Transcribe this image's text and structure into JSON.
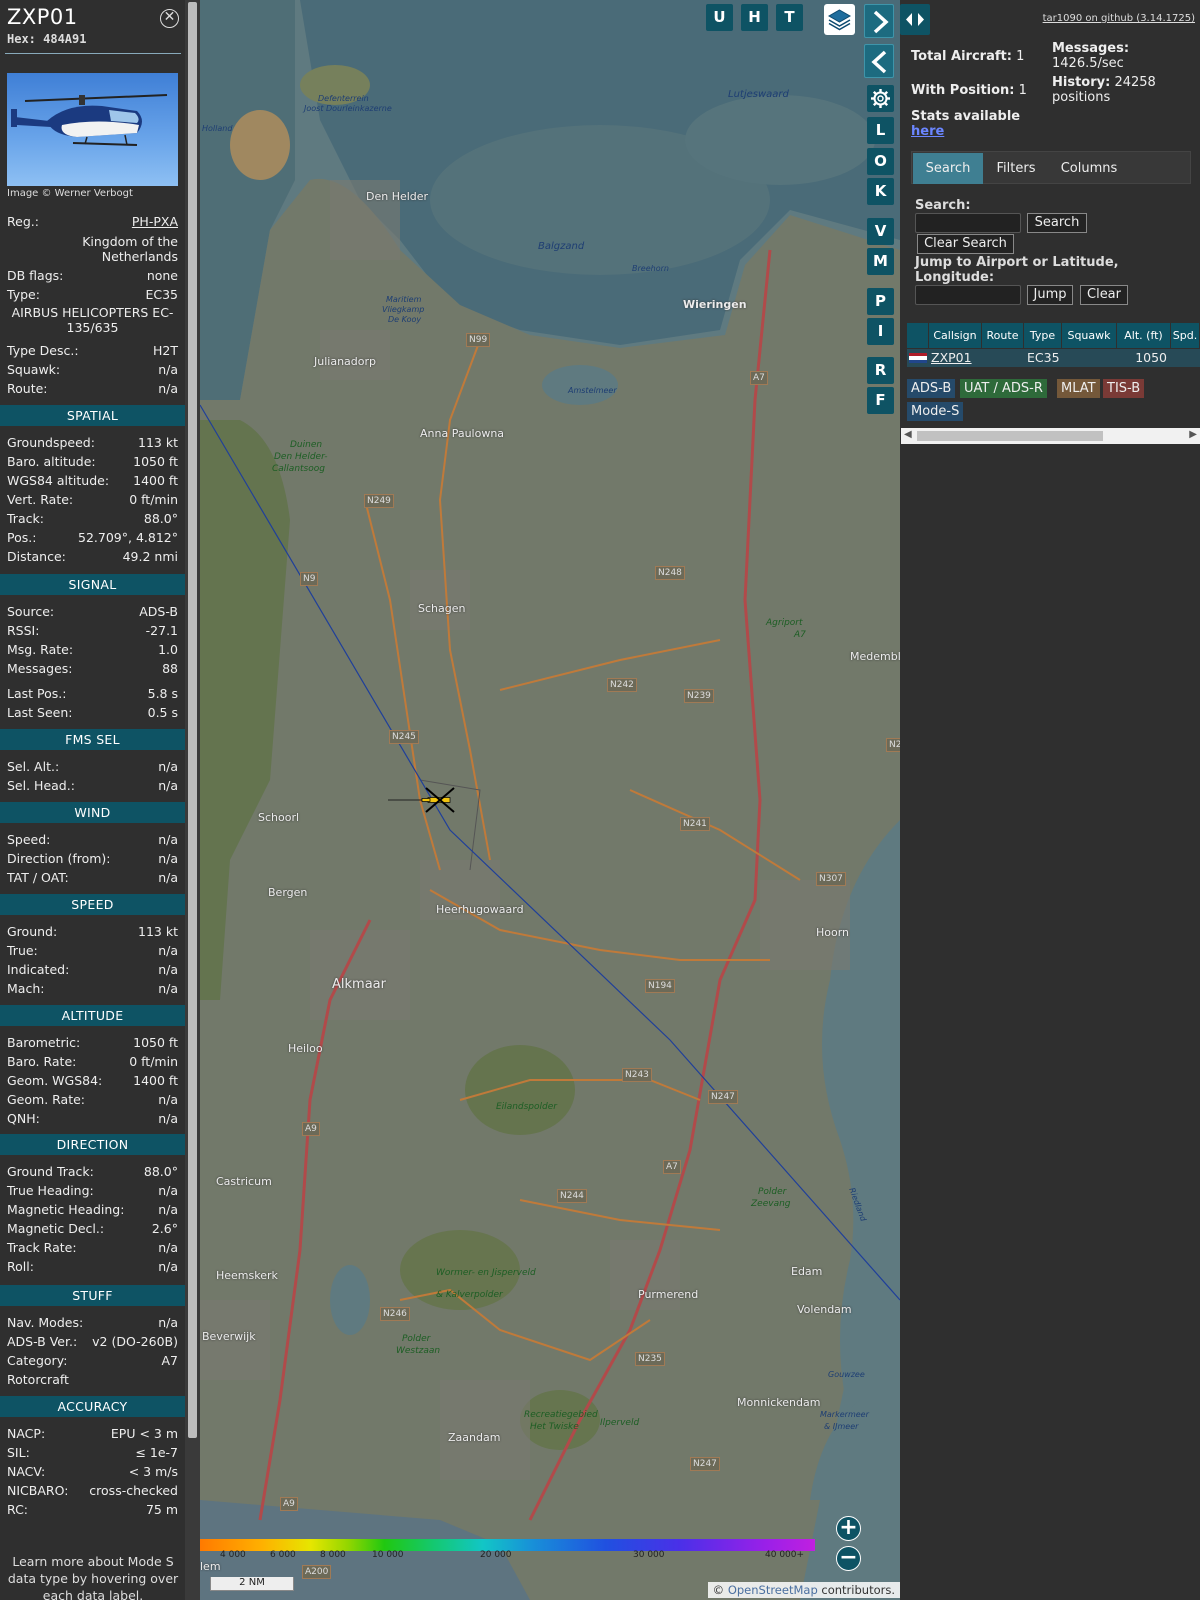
{
  "aircraft": {
    "callsign": "ZXP01",
    "hex": "Hex: 484A91",
    "close_icon": "close-icon",
    "photo_credit": "Image © Werner Verbogt"
  },
  "info": [
    {
      "k": "Reg.:",
      "v": "PH-PXA"
    },
    {
      "k": "",
      "v": "Kingdom of the Netherlands"
    },
    {
      "k": "DB flags:",
      "v": "none"
    },
    {
      "k": "Type:",
      "v": "EC35"
    },
    {
      "k": "",
      "v": "AIRBUS HELICOPTERS EC-135/635"
    },
    {
      "k": "Type Desc.:",
      "v": "H2T"
    },
    {
      "k": "Squawk:",
      "v": "n/a"
    },
    {
      "k": "Route:",
      "v": "n/a"
    }
  ],
  "sections": {
    "spatial": {
      "title": "SPATIAL",
      "rows": [
        {
          "k": "Groundspeed:",
          "v": "113 kt"
        },
        {
          "k": "Baro. altitude:",
          "v": "1050 ft"
        },
        {
          "k": "WGS84 altitude:",
          "v": "1400 ft"
        },
        {
          "k": "Vert. Rate:",
          "v": "0 ft/min"
        },
        {
          "k": "Track:",
          "v": "88.0°"
        },
        {
          "k": "Pos.:",
          "v": "52.709°, 4.812°"
        },
        {
          "k": "Distance:",
          "v": "49.2 nmi"
        }
      ]
    },
    "signal": {
      "title": "SIGNAL",
      "rows": [
        {
          "k": "Source:",
          "v": "ADS-B"
        },
        {
          "k": "RSSI:",
          "v": "-27.1"
        },
        {
          "k": "Msg. Rate:",
          "v": "1.0"
        },
        {
          "k": "Messages:",
          "v": "88"
        },
        {
          "k": "Last Pos.:",
          "v": "5.8 s"
        },
        {
          "k": "Last Seen:",
          "v": "0.5 s"
        }
      ]
    },
    "fms": {
      "title": "FMS SEL",
      "rows": [
        {
          "k": "Sel. Alt.:",
          "v": "n/a"
        },
        {
          "k": "Sel. Head.:",
          "v": "n/a"
        }
      ]
    },
    "wind": {
      "title": "WIND",
      "rows": [
        {
          "k": "Speed:",
          "v": "n/a"
        },
        {
          "k": "Direction (from):",
          "v": "n/a"
        },
        {
          "k": "TAT / OAT:",
          "v": "n/a"
        }
      ]
    },
    "speed": {
      "title": "SPEED",
      "rows": [
        {
          "k": "Ground:",
          "v": "113 kt"
        },
        {
          "k": "True:",
          "v": "n/a"
        },
        {
          "k": "Indicated:",
          "v": "n/a"
        },
        {
          "k": "Mach:",
          "v": "n/a"
        }
      ]
    },
    "altitude": {
      "title": "ALTITUDE",
      "rows": [
        {
          "k": "Barometric:",
          "v": "1050 ft"
        },
        {
          "k": "Baro. Rate:",
          "v": "0 ft/min"
        },
        {
          "k": "Geom. WGS84:",
          "v": "1400 ft"
        },
        {
          "k": "Geom. Rate:",
          "v": "n/a"
        },
        {
          "k": "QNH:",
          "v": "n/a"
        }
      ]
    },
    "direction": {
      "title": "DIRECTION",
      "rows": [
        {
          "k": "Ground Track:",
          "v": "88.0°"
        },
        {
          "k": "True Heading:",
          "v": "n/a"
        },
        {
          "k": "Magnetic Heading:",
          "v": "n/a"
        },
        {
          "k": "Magnetic Decl.:",
          "v": "2.6°"
        },
        {
          "k": "Track Rate:",
          "v": "n/a"
        },
        {
          "k": "Roll:",
          "v": "n/a"
        }
      ]
    },
    "stuff": {
      "title": "STUFF",
      "rows": [
        {
          "k": "Nav. Modes:",
          "v": "n/a"
        },
        {
          "k": "ADS-B Ver.:",
          "v": "v2 (DO-260B)"
        },
        {
          "k": "Category:",
          "v": "A7"
        },
        {
          "k": "Rotorcraft",
          "v": ""
        }
      ]
    },
    "accuracy": {
      "title": "ACCURACY",
      "rows": [
        {
          "k": "NACP:",
          "v": "EPU < 3 m"
        },
        {
          "k": "SIL:",
          "v": "≤ 1e-7"
        },
        {
          "k": "NACV:",
          "v": "< 3 m/s"
        },
        {
          "k": "NICBARO:",
          "v": "cross-checked"
        },
        {
          "k": "RC:",
          "v": "75 m"
        }
      ]
    }
  },
  "footer_note": "Learn more about Mode S data type by hovering over each data label.",
  "map": {
    "buttons_top": [
      "U",
      "H",
      "T"
    ],
    "side_buttons": [
      "L",
      "O",
      "K",
      "V",
      "M",
      "P",
      "I",
      "R",
      "F"
    ],
    "labels": {
      "den_helder": "Den Helder",
      "wieringen": "Wieringen",
      "julianadorp": "Julianadorp",
      "anna_paulowna": "Anna Paulowna",
      "schagen": "Schagen",
      "schoorl": "Schoorl",
      "bergen": "Bergen",
      "heerhugowaard": "Heerhugowaard",
      "hoorn": "Hoorn",
      "alkmaar": "Alkmaar",
      "heiloo": "Heiloo",
      "castricum": "Castricum",
      "heemskerk": "Heemskerk",
      "beverwijk": "Beverwijk",
      "purmerend": "Purmerend",
      "edam": "Edam",
      "volendam": "Volendam",
      "monnickendam": "Monnickendam",
      "zaandam": "Zaandam",
      "medemblik": "Medembli",
      "balgzand": "Balgzand",
      "breehorn": "Breehorn",
      "lutjeswaard": "Lutjeswaard",
      "amstelmeer": "Amstelmeer",
      "defenterrein": "Defenterrein",
      "kazerne": "Joost Dourleinkazerne",
      "vliegkamp1": "Maritiem",
      "vliegkamp2": "Vliegkamp",
      "vliegkamp3": "De Kooy",
      "duinen1": "Duinen",
      "duinen2": "Den Helder-",
      "duinen3": "Callantsoog",
      "agriport1": "Agriport",
      "agriport2": "A7",
      "eilandspolder": "Eilandspolder",
      "polder1": "Polder",
      "polder2": "Zeevang",
      "markermeer1": "Markermeer",
      "markermeer2": "& IJmeer",
      "gouwzee": "Gouwzee",
      "wormer1": "Wormer- en Jisperveld",
      "wormer2": "& Kalverpolder",
      "westzaan1": "Polder",
      "westzaan2": "Westzaan",
      "twiske1": "Recreatiegebied",
      "twiske2": "Het Twiske",
      "ilperveld": "Ilperveld",
      "leek": "Holland",
      "riedland": "Riedland",
      "haarlem": "lem"
    },
    "roads": [
      "N99",
      "A7",
      "N249",
      "N9",
      "N248",
      "N242",
      "N239",
      "N245",
      "N241",
      "N307",
      "N194",
      "N243",
      "N247",
      "A9",
      "A7",
      "N244",
      "N246",
      "N235",
      "N247",
      "A9",
      "A200",
      "N2"
    ],
    "scale": "2 NM",
    "alt_ticks": [
      "4 000",
      "6 000",
      "8 000",
      "10 000",
      "20 000",
      "30 000",
      "40 000+"
    ],
    "attribution_prefix": "© ",
    "attribution_link": "OpenStreetMap",
    "attribution_suffix": " contributors."
  },
  "right": {
    "github": "tar1090 on github (3.14.1725)",
    "total_label": "Total Aircraft:",
    "total_value": "1",
    "withpos_label": "With Position:",
    "withpos_value": "1",
    "messages_label": "Messages:",
    "messages_value": "1426.5/sec",
    "history_label": "History:",
    "history_value": "24258 positions",
    "stats_label": "Stats available",
    "stats_link": "here",
    "tabs": [
      "Search",
      "Filters",
      "Columns"
    ],
    "search_label": "Search:",
    "search_button": "Search",
    "clear_search": "Clear Search",
    "jump_label": "Jump to Airport or Latitude, Longitude:",
    "jump_button": "Jump",
    "clear_button": "Clear",
    "columns": [
      "Callsign",
      "Route",
      "Type",
      "Squawk",
      "Alt. (ft)",
      "Spd."
    ],
    "row": {
      "callsign": "ZXP01",
      "route": "",
      "type": "EC35",
      "squawk": "",
      "alt": "1050",
      "spd": ""
    },
    "badges": [
      {
        "label": "ADS-B",
        "color": "#254a6a"
      },
      {
        "label": "UAT / ADS-R",
        "color": "#2e6a3a"
      },
      {
        "label": "MLAT",
        "color": "#74583a"
      },
      {
        "label": "TIS-B",
        "color": "#7a3a36"
      },
      {
        "label": "Mode-S",
        "color": "#254a6a"
      }
    ]
  }
}
